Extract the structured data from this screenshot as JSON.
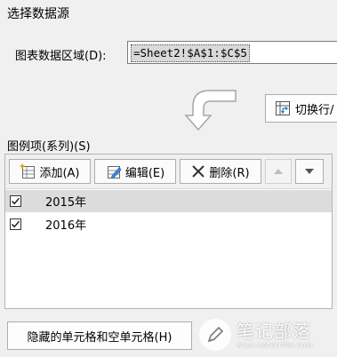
{
  "dialog": {
    "title": "选择数据源"
  },
  "chart_range": {
    "label": "图表数据区域(D):",
    "value": "=Sheet2!$A$1:$C$5"
  },
  "switch_button": {
    "label": "切换行/"
  },
  "legend": {
    "section_label": "图例项(系列)(S)",
    "toolbar": {
      "add_label": "添加(A)",
      "edit_label": "编辑(E)",
      "delete_label": "删除(R)"
    },
    "items": [
      {
        "label": "2015年",
        "checked": true,
        "selected": true
      },
      {
        "label": "2016年",
        "checked": true,
        "selected": false
      }
    ]
  },
  "hidden_cells_button": {
    "label": "隐藏的单元格和空单元格(H)"
  },
  "watermark": {
    "brand": "笔记部落",
    "url": "www.notetribe.com"
  },
  "colors": {
    "dialog_bg": "#f0f0f0",
    "selected_row": "#dcdcdc",
    "arrow_gray": "#a6a6a6"
  }
}
